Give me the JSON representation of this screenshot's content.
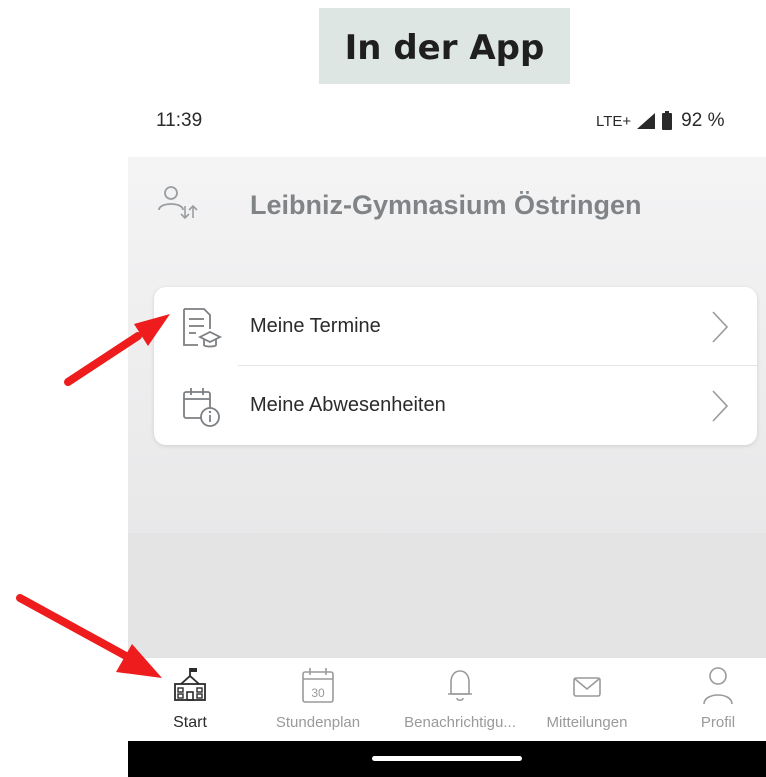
{
  "banner": {
    "title": "In der App"
  },
  "status_bar": {
    "time": "11:39",
    "network": "LTE+",
    "battery": "92 %"
  },
  "header": {
    "school_name": "Leibniz-Gymnasium Östringen"
  },
  "menu": {
    "items": [
      {
        "label": "Meine Termine",
        "icon": "appointments-icon"
      },
      {
        "label": "Meine Abwesenheiten",
        "icon": "absences-icon"
      }
    ]
  },
  "nav": {
    "items": [
      {
        "label": "Start",
        "icon": "school-icon",
        "active": true
      },
      {
        "label": "Stundenplan",
        "icon": "calendar-icon",
        "date": "30"
      },
      {
        "label": "Benachrichtigu...",
        "icon": "bell-icon"
      },
      {
        "label": "Mitteilungen",
        "icon": "envelope-icon"
      },
      {
        "label": "Profil",
        "icon": "profile-icon"
      }
    ]
  },
  "colors": {
    "annotation_arrow": "#ee1c1c",
    "banner_bg": "#dde6e2"
  }
}
